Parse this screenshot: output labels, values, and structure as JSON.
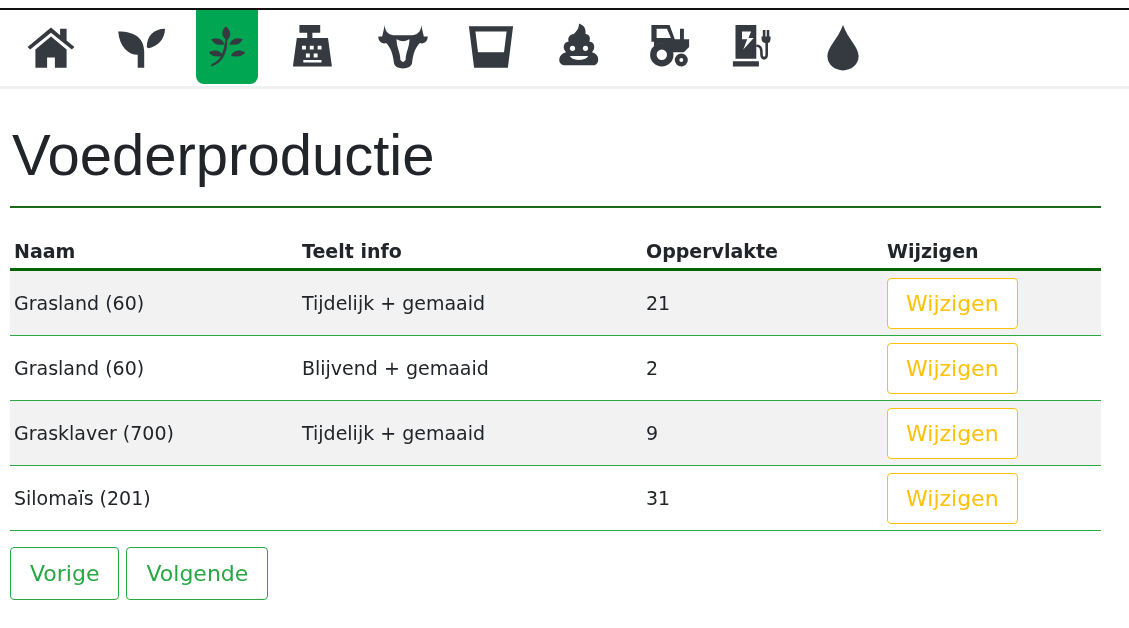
{
  "nav": [
    {
      "kind": "home",
      "selected": false
    },
    {
      "kind": "sprout",
      "selected": false
    },
    {
      "kind": "leaf",
      "selected": true
    },
    {
      "kind": "register",
      "selected": false
    },
    {
      "kind": "cow",
      "selected": false
    },
    {
      "kind": "glass",
      "selected": false
    },
    {
      "kind": "poop",
      "selected": false
    },
    {
      "kind": "tractor",
      "selected": false
    },
    {
      "kind": "charger",
      "selected": false
    },
    {
      "kind": "drop",
      "selected": false
    }
  ],
  "title": "Voederproductie",
  "table": {
    "columns": [
      "Naam",
      "Teelt info",
      "Oppervlakte",
      "Wijzigen"
    ],
    "rows": [
      {
        "naam": "Grasland (60)",
        "teelt_info": "Tijdelijk + gemaaid",
        "oppervlakte": "21",
        "action": "Wijzigen"
      },
      {
        "naam": "Grasland (60)",
        "teelt_info": "Blijvend + gemaaid",
        "oppervlakte": "2",
        "action": "Wijzigen"
      },
      {
        "naam": "Grasklaver (700)",
        "teelt_info": "Tijdelijk + gemaaid",
        "oppervlakte": "9",
        "action": "Wijzigen"
      },
      {
        "naam": "Silomaïs (201)",
        "oppervlakte": "31",
        "action": "Wijzigen"
      }
    ]
  },
  "pagination": [
    "Vorige",
    "Volgende"
  ]
}
